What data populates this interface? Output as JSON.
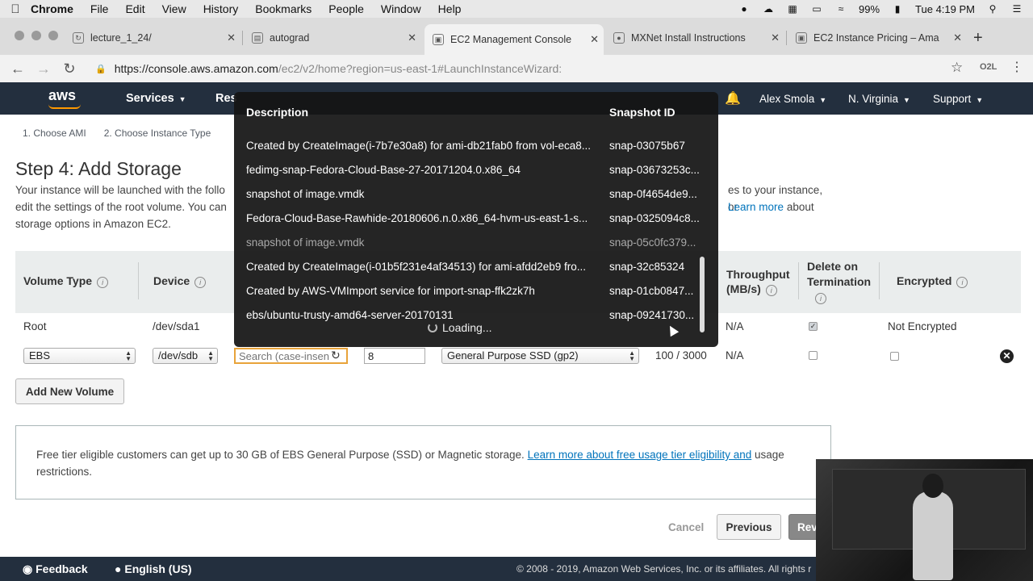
{
  "macbar": {
    "app_name": "Chrome",
    "menus": [
      "File",
      "Edit",
      "View",
      "History",
      "Bookmarks",
      "People",
      "Window",
      "Help"
    ],
    "battery": "99%",
    "clock": "Tue 4:19 PM"
  },
  "tabs": [
    {
      "title": "lecture_1_24/",
      "active": false
    },
    {
      "title": "autograd",
      "active": false
    },
    {
      "title": "EC2 Management Console",
      "active": true
    },
    {
      "title": "MXNet Install Instructions",
      "active": false
    },
    {
      "title": "EC2 Instance Pricing – Ama",
      "active": false
    }
  ],
  "address": {
    "host": "https://console.aws.amazon.com",
    "path": "/ec2/v2/home?region=us-east-1#LaunchInstanceWizard:",
    "extension": "O2L"
  },
  "awsnav": {
    "logo": "aws",
    "services": "Services",
    "resource_groups": "Res",
    "user": "Alex Smola",
    "region": "N. Virginia",
    "support": "Support"
  },
  "wizard": {
    "steps": [
      "1. Choose AMI",
      "2. Choose Instance Type"
    ],
    "title": "Step 4: Add Storage",
    "description_pre": "Your instance will be launched with the follo",
    "description_right1": "es to your instance, or",
    "description_line2_pre": "edit the settings of the root volume. You can",
    "description_link": "Learn more",
    "description_line2_post": "about",
    "description_line3": "storage options in Amazon EC2."
  },
  "table": {
    "headers": {
      "volume_type": "Volume Type",
      "device": "Device",
      "throughput": "Throughput (MB/s)",
      "throughput_line1": "Throughput",
      "throughput_line2": "(MB/s)",
      "delete_line1": "Delete on",
      "delete_line2": "Termination",
      "encrypted": "Encrypted"
    },
    "root_row": {
      "volume_type": "Root",
      "device": "/dev/sda1",
      "throughput": "N/A",
      "delete_on_termination": true,
      "encrypted": "Not Encrypted"
    },
    "ebs_row": {
      "volume_type": "EBS",
      "device": "/dev/sdb",
      "snapshot_placeholder": "Search (case-insen",
      "size": "8",
      "volume_kind": "General Purpose SSD (gp2)",
      "iops": "100 / 3000",
      "throughput": "N/A",
      "delete_on_termination": false,
      "encrypted": false
    }
  },
  "add_volume_label": "Add New Volume",
  "free_tier": {
    "text_pre": "Free tier eligible customers can get up to 30 GB of EBS General Purpose (SSD) or Magnetic storage.",
    "link": "Learn more about free usage tier eligibility and",
    "text_post": "usage restrictions."
  },
  "actions": {
    "cancel": "Cancel",
    "previous": "Previous",
    "review": "Rev"
  },
  "footer": {
    "feedback": "Feedback",
    "language": "English (US)",
    "copyright": "© 2008 - 2019, Amazon Web Services, Inc. or its affiliates. All rights r"
  },
  "snapshot_dropdown": {
    "col_description": "Description",
    "col_snapshot": "Snapshot ID",
    "rows": [
      {
        "description": "Created by CreateImage(i-7b7e30a8) for ami-db21fab0 from vol-eca8...",
        "snapshot": "snap-03075b67"
      },
      {
        "description": "fedimg-snap-Fedora-Cloud-Base-27-20171204.0.x86_64",
        "snapshot": "snap-03673253c..."
      },
      {
        "description": "snapshot of image.vmdk",
        "snapshot": "snap-0f4654de9..."
      },
      {
        "description": "Fedora-Cloud-Base-Rawhide-20180606.n.0.x86_64-hvm-us-east-1-s...",
        "snapshot": "snap-0325094c8..."
      },
      {
        "description": "snapshot of image.vmdk",
        "snapshot": "snap-05c0fc379..."
      },
      {
        "description": "Created by CreateImage(i-01b5f231e4af34513) for ami-afdd2eb9 fro...",
        "snapshot": "snap-32c85324"
      },
      {
        "description": "Created by AWS-VMImport service for import-snap-ffk2zk7h",
        "snapshot": "snap-01cb0847..."
      },
      {
        "description": "ebs/ubuntu-trusty-amd64-server-20170131",
        "snapshot": "snap-09241730..."
      }
    ],
    "loading": "Loading..."
  }
}
